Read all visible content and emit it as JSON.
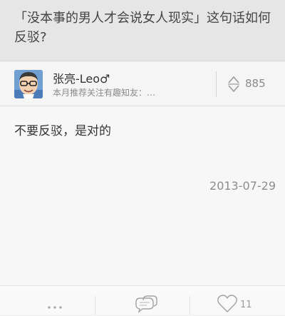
{
  "question": {
    "title": "「没本事的男人才会说女人现实」这句话如何反驳?"
  },
  "author": {
    "name": "张亮-Leo♂",
    "bio": "本月推荐关注有趣知友：…",
    "avatar_icon": "cartoon-avatar-icon"
  },
  "vote": {
    "count": "885",
    "icon": "vote-up-down-icon"
  },
  "answer": {
    "text": "不要反驳，是对的",
    "date": "2013-07-29"
  },
  "bottom_bar": {
    "more_icon": "more-dots-icon",
    "comment_icon": "comment-bubble-icon",
    "thanks_icon": "heart-icon",
    "thanks_count": "11"
  },
  "colors": {
    "header_bg": "#e6e6e6",
    "body_bg": "#f7f7f7",
    "muted_text": "#8a8a8a"
  }
}
